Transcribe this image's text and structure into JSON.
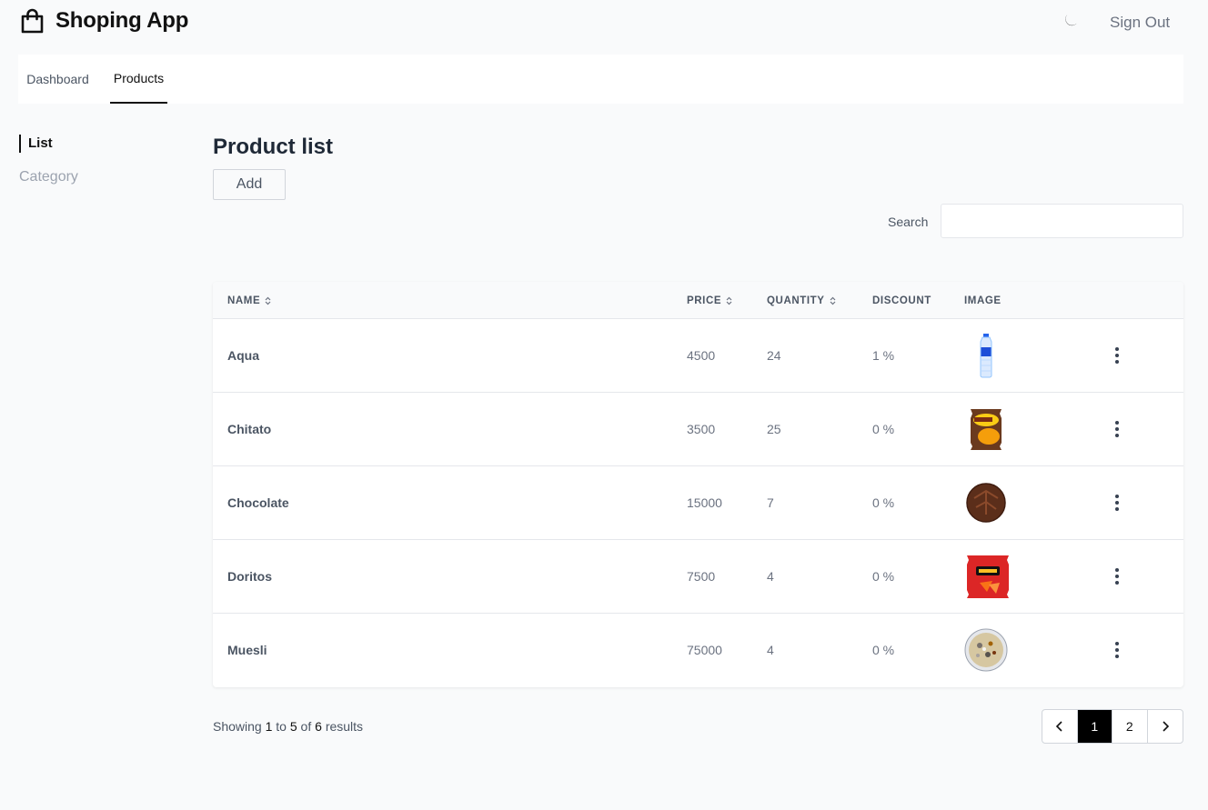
{
  "app": {
    "title": "Shoping App",
    "sign_out": "Sign Out"
  },
  "nav": {
    "tabs": [
      {
        "label": "Dashboard"
      },
      {
        "label": "Products"
      }
    ]
  },
  "sidebar": {
    "items": [
      {
        "label": "List"
      },
      {
        "label": "Category"
      }
    ]
  },
  "main": {
    "title": "Product list",
    "add_label": "Add",
    "search_label": "Search",
    "search_value": "",
    "search_placeholder": ""
  },
  "table": {
    "headers": {
      "name": "NAME",
      "price": "PRICE",
      "quantity": "QUANTITY",
      "discount": "DISCOUNT",
      "image": "IMAGE"
    },
    "rows": [
      {
        "name": "Aqua",
        "price": "4500",
        "quantity": "24",
        "discount": "1 %",
        "image": "water-bottle-image"
      },
      {
        "name": "Chitato",
        "price": "3500",
        "quantity": "25",
        "discount": "0 %",
        "image": "chips-bag-image"
      },
      {
        "name": "Chocolate",
        "price": "15000",
        "quantity": "7",
        "discount": "0 %",
        "image": "chocolate-image"
      },
      {
        "name": "Doritos",
        "price": "7500",
        "quantity": "4",
        "discount": "0 %",
        "image": "doritos-bag-image"
      },
      {
        "name": "Muesli",
        "price": "75000",
        "quantity": "4",
        "discount": "0 %",
        "image": "muesli-bowl-image"
      }
    ]
  },
  "footer": {
    "showing_prefix": "Showing",
    "from": "1",
    "to_word": "to",
    "to": "5",
    "of_word": "of",
    "total": "6",
    "results_word": "results",
    "pages": [
      "1",
      "2"
    ],
    "current_page": "1"
  },
  "colors": {
    "active": "#000000",
    "background": "#f9fafb",
    "muted": "#9ca3af"
  }
}
